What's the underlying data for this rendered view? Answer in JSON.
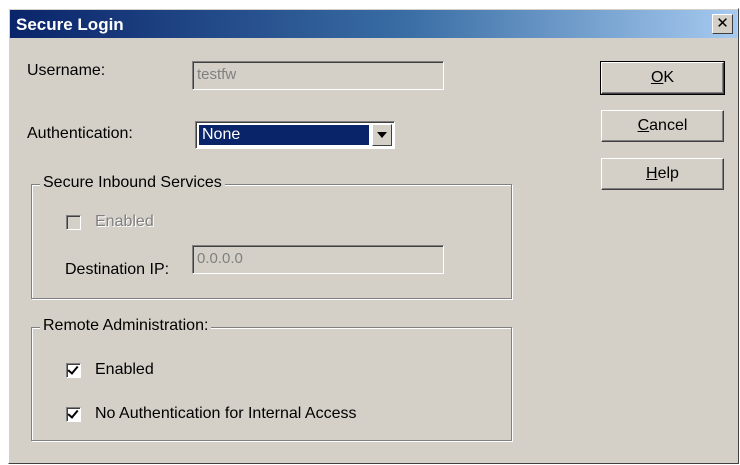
{
  "dialog": {
    "title": "Secure Login",
    "close_glyph": "✕"
  },
  "username": {
    "label": "Username:",
    "value": "testfw"
  },
  "authentication": {
    "label": "Authentication:",
    "selected": "None"
  },
  "secure_inbound": {
    "legend": "Secure Inbound Services",
    "enabled_label": "Enabled",
    "enabled_checked": false,
    "destination_ip_label": "Destination IP:",
    "destination_ip_value": "0.0.0.0"
  },
  "remote_admin": {
    "legend": "Remote Administration:",
    "enabled_label": "Enabled",
    "enabled_checked": true,
    "no_auth_label": "No Authentication for Internal Access",
    "no_auth_checked": true
  },
  "buttons": {
    "ok_mnemonic": "O",
    "ok_rest": "K",
    "cancel_mnemonic": "C",
    "cancel_rest": "ancel",
    "help_mnemonic": "H",
    "help_rest": "elp"
  }
}
